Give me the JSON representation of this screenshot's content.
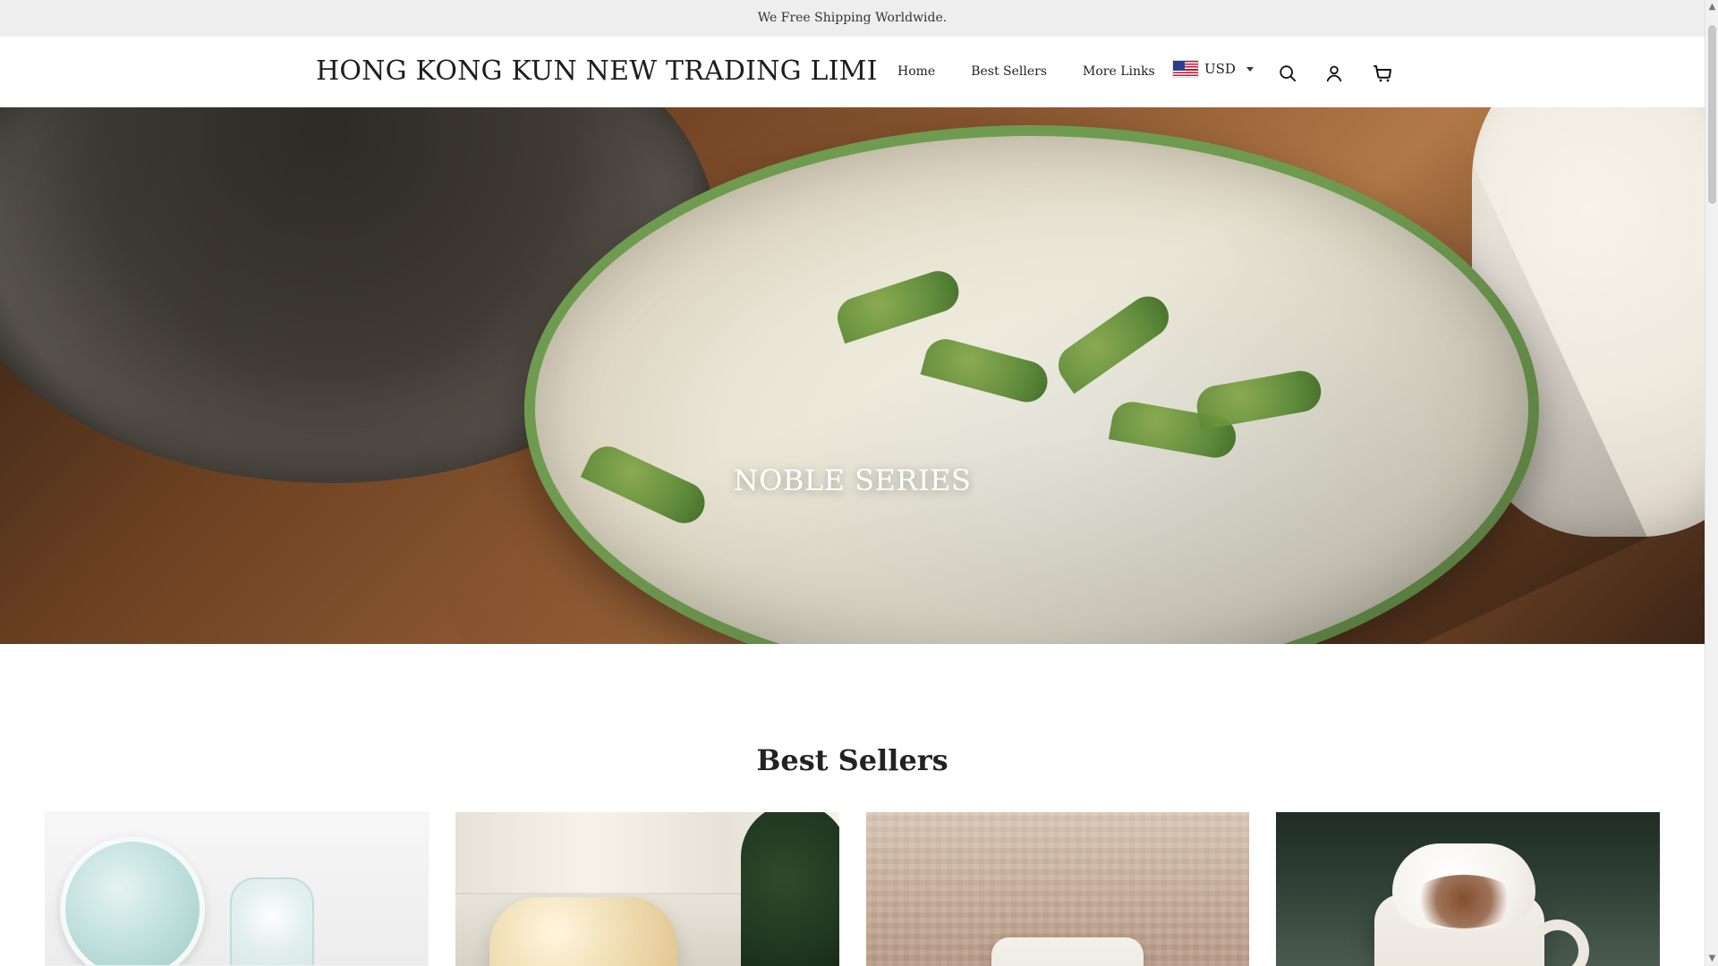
{
  "announcement": {
    "text": "We Free Shipping Worldwide."
  },
  "header": {
    "logo_text": "HONG KONG KUN NEW TRADING LIMI",
    "nav": [
      {
        "label": "Home"
      },
      {
        "label": "Best Sellers"
      },
      {
        "label": "More Links"
      }
    ],
    "currency": {
      "code": "USD",
      "flag": "us-flag"
    },
    "icons": {
      "search": "search-icon",
      "account": "user-icon",
      "cart": "cart-icon"
    }
  },
  "hero": {
    "title": "NOBLE SERIES",
    "slides": 2,
    "active_slide": 1
  },
  "best_sellers": {
    "title": "Best Sellers",
    "products": [
      {
        "image": "product-image-glass-vases"
      },
      {
        "image": "product-image-popcorn-bowl"
      },
      {
        "image": "product-image-mug-with-sweater"
      },
      {
        "image": "product-image-hot-chocolate-mug"
      }
    ]
  },
  "colors": {
    "topbar_bg": "#eeeeee",
    "text": "#222222",
    "scroll_thumb": "#c7c7c7"
  }
}
